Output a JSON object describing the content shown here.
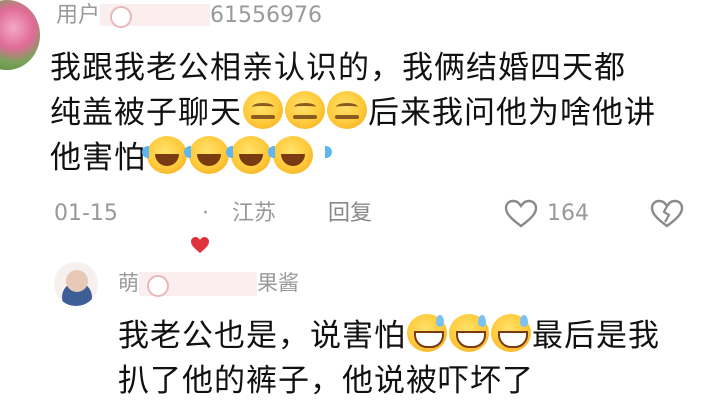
{
  "comment": {
    "user_prefix": "用户",
    "user_suffix": "61556976",
    "lines": [
      {
        "text": "我跟我老公相亲认识的，我俩结婚四天都"
      },
      {
        "pre": "纯盖被子聊天",
        "post": "后来我问他为啥他讲"
      },
      {
        "pre": "他害怕"
      }
    ],
    "date": "01-15",
    "dot": "·",
    "location": "江苏",
    "reply_label": "回复",
    "like_count": "164"
  },
  "reply": {
    "name_prefix": "萌",
    "name_suffix": "果酱",
    "line1_pre": "我老公也是，说害怕",
    "line1_post": "最后是我",
    "line2": "扒了他的裤子，他说被吓坏了"
  },
  "colors": {
    "text": "#111111",
    "meta": "#999999",
    "heart": "#e0333e",
    "mask": "#fbeeee"
  },
  "icons": [
    "heart-outline-icon",
    "broken-heart-icon",
    "author-liked-heart-icon"
  ]
}
